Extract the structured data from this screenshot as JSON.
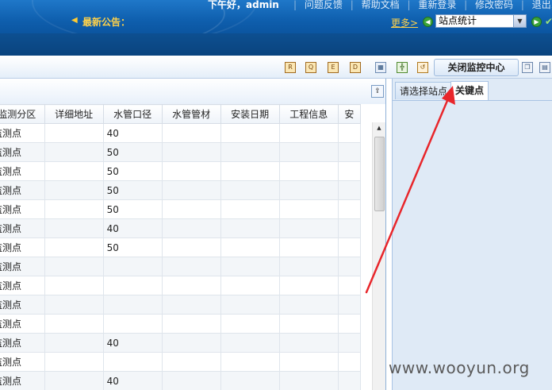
{
  "header": {
    "greeting": "下午好，admin",
    "links": [
      "问题反馈",
      "帮助文档",
      "重新登录",
      "修改密码",
      "退出系"
    ],
    "notice_label": "最新公告：",
    "more_label": "更多>",
    "site_select_value": "站点统计"
  },
  "toolbar": {
    "close_monitor_label": "关闭监控中心",
    "icons": [
      "report-icon",
      "query-icon",
      "edit-icon",
      "document-icon",
      "chart-icon",
      "tree-icon",
      "refresh-icon"
    ]
  },
  "grid": {
    "columns": [
      "监测分区",
      "详细地址",
      "水管口径",
      "水管管材",
      "安装日期",
      "工程信息",
      "安"
    ],
    "rows": [
      [
        "监测点",
        "",
        "40",
        "",
        "",
        ""
      ],
      [
        "监测点",
        "",
        "50",
        "",
        "",
        ""
      ],
      [
        "监测点",
        "",
        "50",
        "",
        "",
        ""
      ],
      [
        "监测点",
        "",
        "50",
        "",
        "",
        ""
      ],
      [
        "监测点",
        "",
        "50",
        "",
        "",
        ""
      ],
      [
        "监测点",
        "",
        "40",
        "",
        "",
        ""
      ],
      [
        "监测点",
        "",
        "50",
        "",
        "",
        ""
      ],
      [
        "监测点",
        "",
        "",
        "",
        "",
        ""
      ],
      [
        "监测点",
        "",
        "",
        "",
        "",
        ""
      ],
      [
        "监测点",
        "",
        "",
        "",
        "",
        ""
      ],
      [
        "监测点",
        "",
        "",
        "",
        "",
        ""
      ],
      [
        "监测点",
        "",
        "40",
        "",
        "",
        ""
      ],
      [
        "监测点",
        "",
        "",
        "",
        "",
        ""
      ],
      [
        "监测点",
        "",
        "40",
        "",
        "",
        ""
      ]
    ]
  },
  "right_panel": {
    "tabs": [
      "请选择站点",
      "关键点"
    ],
    "active_tab": 1
  },
  "annotation": {
    "color": "#e8262b"
  },
  "watermark": "www.wooyun.org"
}
